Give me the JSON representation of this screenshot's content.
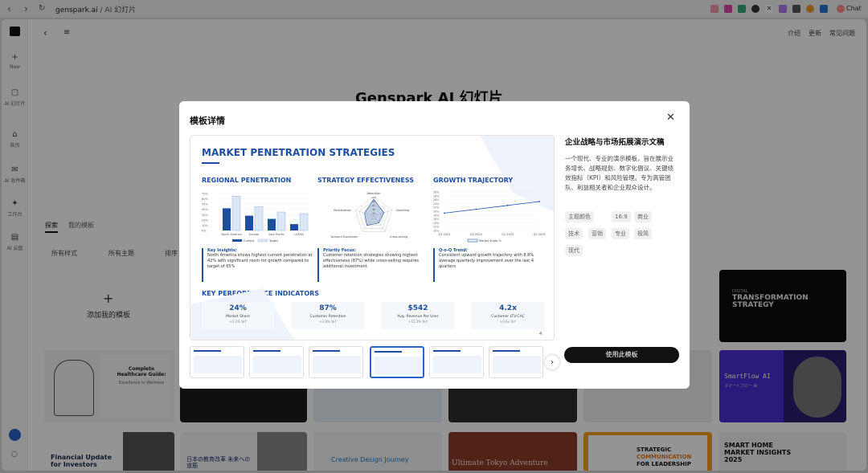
{
  "browser": {
    "domain": "genspark.ai",
    "path": " / AI 幻灯片",
    "chat_label": "Chat"
  },
  "header_links": {
    "intro": "介绍",
    "update": "更新",
    "faq": "常见问题"
  },
  "sidebar": [
    {
      "icon": "+",
      "label": "New"
    },
    {
      "icon": "▢",
      "label": "AI 幻灯片"
    },
    {
      "icon": "⌂",
      "label": "首页"
    },
    {
      "icon": "✉",
      "label": "AI 收件箱"
    },
    {
      "icon": "✦",
      "label": "工作台"
    },
    {
      "icon": "▤",
      "label": "AI 云盘"
    }
  ],
  "page": {
    "title": "Genspark AI 幻灯片",
    "tab_explore": "探索",
    "tab_mine": "我的模板",
    "filter_style": "所有样式",
    "filter_theme": "所有主题",
    "filter_sort": "排序",
    "add_template": "添加我的模板"
  },
  "bg_cards": {
    "c1_title": "Complete Healthcare Guide:",
    "c1_sub": "Excellence in Wellness",
    "dt_small": "DIGITAL",
    "dt_title": "TRANSFORMATION STRATEGY",
    "sf": "SmartFlow AI",
    "sf_jp": "スマートフロー AI",
    "fin": "Financial Update for Investors",
    "jp": "日本の教育改革 未来への道筋",
    "cdj": "Creative Design Journey",
    "tokyo": "Ultimate Tokyo Adventure",
    "strat1": "STRATEGIC",
    "strat2": "COMMUNICATION",
    "strat3": "FOR LEADERSHIP",
    "sh1": "SMART HOME",
    "sh2": "MARKET INSIGHTS",
    "sh3": "2025"
  },
  "modal": {
    "title": "模板详情",
    "name": "企业战略与市场拓展演示文稿",
    "desc": "一个现代、专业的演示模板，旨在展示业务增长、战略规划、数字化倡议、关键绩效指标（KPI）和风险管理。专为高管团队、利益相关者和企业观众设计。",
    "tags": [
      "主题颜色",
      "16:9",
      "商业",
      "技术",
      "营销",
      "专业",
      "极简",
      "现代"
    ],
    "use_button": "使用此模板"
  },
  "slide": {
    "title": "MARKET PENETRATION STRATEGIES",
    "sec1": "REGIONAL PENETRATION",
    "sec2": "STRATEGY EFFECTIVENESS",
    "sec3": "GROWTH TRAJECTORY",
    "ins1_h": "Key Insights:",
    "ins1": "North America shows highest current penetration at 42% with significant room for growth compared to target of 65%",
    "ins2_h": "Priority Focus:",
    "ins2": "Customer retention strategies showing highest effectiveness (87%) while cross-selling requires additional investment",
    "ins3_h": "Q-o-Q Trend:",
    "ins3": "Consistent upward growth trajectory with 6.8% average quarterly improvement over the last 4 quarters",
    "kpi_title": "KEY PERFORMANCE INDICATORS",
    "kpis": [
      {
        "v": "24%",
        "l": "Market Share",
        "d": "+4.2% YoY"
      },
      {
        "v": "87%",
        "l": "Customer Retention",
        "d": "+3.8% YoY"
      },
      {
        "v": "$542",
        "l": "Avg. Revenue Per User",
        "d": "+12.3% YoY"
      },
      {
        "v": "4.2x",
        "l": "Customer LTV:CAC",
        "d": "+0.6x YoY"
      }
    ],
    "page_num": "4",
    "bar_legend_current": "Current",
    "bar_legend_target": "Target",
    "line_legend": "Market Share %",
    "radar_axes": [
      "Retention",
      "Upselling",
      "Cross-selling",
      "Account Expansion",
      "Reactivation"
    ],
    "radar_ticks": [
      "100",
      "80",
      "60",
      "40",
      "20"
    ]
  },
  "chart_data": [
    {
      "type": "bar",
      "title": "REGIONAL PENETRATION",
      "categories": [
        "North America",
        "Europe",
        "Asia Pacific",
        "LATAM"
      ],
      "series": [
        {
          "name": "Current",
          "values": [
            42,
            28,
            22,
            12
          ]
        },
        {
          "name": "Target",
          "values": [
            65,
            45,
            35,
            32
          ]
        }
      ],
      "yticks": [
        "70%",
        "60%",
        "50%",
        "40%",
        "30%",
        "20%",
        "10%",
        "0%"
      ],
      "ylim": [
        0,
        70
      ]
    },
    {
      "type": "line",
      "title": "GROWTH TRAJECTORY",
      "x": [
        "Q3 2024",
        "Q4 2024",
        "Q1 2025",
        "Q2 2025"
      ],
      "series": [
        {
          "name": "Market Share %",
          "values": [
            19,
            21,
            23,
            25
          ]
        }
      ],
      "yticks": [
        "30%",
        "28%",
        "26%",
        "24%",
        "22%",
        "20%",
        "18%",
        "16%",
        "14%",
        "12%",
        "10%"
      ],
      "ylim": [
        10,
        30
      ]
    },
    {
      "type": "radar",
      "title": "STRATEGY EFFECTIVENESS"
    }
  ],
  "colors": {
    "accent": "#1d4ea0",
    "button": "#111111"
  }
}
